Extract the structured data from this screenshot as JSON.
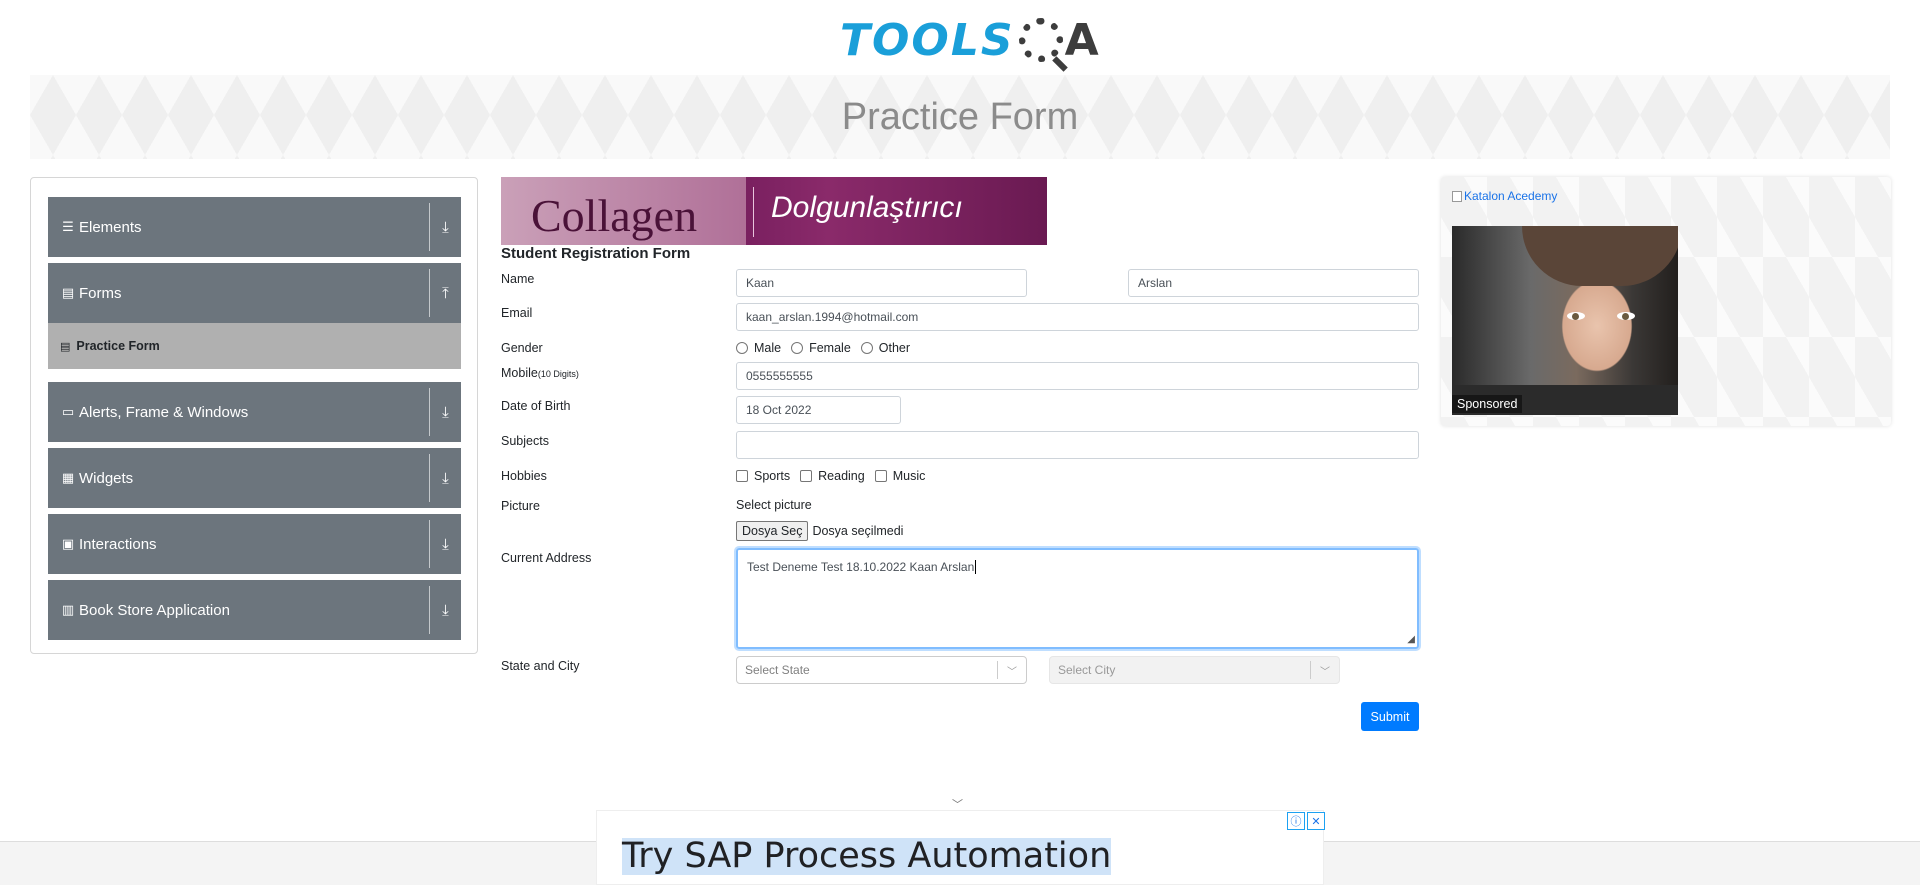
{
  "header": {
    "logo_left": "TOOLS",
    "logo_right": "A",
    "page_title": "Practice Form"
  },
  "sidebar": {
    "groups": [
      {
        "label": "Elements",
        "icon": "menu-icon",
        "arrow": "⤓"
      },
      {
        "label": "Forms",
        "icon": "document-icon",
        "arrow": "⤒"
      },
      {
        "label": "Alerts, Frame & Windows",
        "icon": "window-icon",
        "arrow": "⤓"
      },
      {
        "label": "Widgets",
        "icon": "grid-icon",
        "arrow": "⤓"
      },
      {
        "label": "Interactions",
        "icon": "cursor-icon",
        "arrow": "⤓"
      },
      {
        "label": "Book Store Application",
        "icon": "books-icon",
        "arrow": "⤓"
      }
    ],
    "active_item": "Practice Form"
  },
  "ad_top": {
    "text1": "Collagen",
    "text2": "Dolgunlaştırıcı"
  },
  "form": {
    "title": "Student Registration Form",
    "name_label": "Name",
    "first_name": "Kaan",
    "last_name": "Arslan",
    "email_label": "Email",
    "email": "kaan_arslan.1994@hotmail.com",
    "gender_label": "Gender",
    "gender_options": [
      "Male",
      "Female",
      "Other"
    ],
    "mobile_label": "Mobile",
    "mobile_hint": "(10 Digits)",
    "mobile": "0555555555",
    "dob_label": "Date of Birth",
    "dob": "18 Oct 2022",
    "subjects_label": "Subjects",
    "subjects": "",
    "hobbies_label": "Hobbies",
    "hobbies": [
      "Sports",
      "Reading",
      "Music"
    ],
    "picture_label": "Picture",
    "select_picture": "Select picture",
    "file_button": "Dosya Seç",
    "file_status": "Dosya seçilmedi",
    "address_label": "Current Address",
    "address": "Test Deneme Test 18.10.2022 Kaan Arslan",
    "state_city_label": "State and City",
    "state_placeholder": "Select State",
    "city_placeholder": "Select City",
    "submit": "Submit"
  },
  "right_ad": {
    "link_text": "Katalon Acedemy",
    "sponsored": "Sponsored"
  },
  "bottom_ad": {
    "text": "Try SAP Process Automation",
    "info_icon": "ⓘ",
    "close_icon": "✕"
  },
  "colors": {
    "sidebar_group": "#6c757d",
    "submit": "#007bff",
    "logo_blue": "#1a9fd9"
  }
}
